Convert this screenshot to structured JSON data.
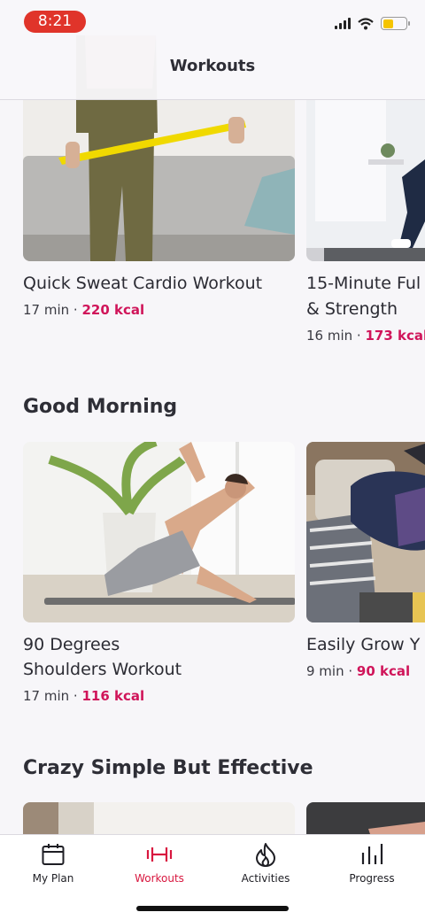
{
  "status_bar": {
    "time": "8:21"
  },
  "header": {
    "title": "Workouts"
  },
  "top_row": [
    {
      "title": "Quick Sweat Cardio Workout",
      "duration": "17 min · ",
      "kcal": "220 kcal"
    },
    {
      "title_line1": "15-Minute Ful",
      "title_line2": "& Strength",
      "duration": "16 min · ",
      "kcal": "173 kcal"
    }
  ],
  "sections": [
    {
      "title": "Good Morning",
      "cards": [
        {
          "title_line1": "90 Degrees",
          "title_line2": "Shoulders Workout",
          "duration": "17 min · ",
          "kcal": "116 kcal"
        },
        {
          "title_line1": "Easily Grow Y",
          "duration": "9 min · ",
          "kcal": "90 kcal"
        }
      ]
    },
    {
      "title": "Crazy Simple But Effective"
    }
  ],
  "tabbar": {
    "tabs": [
      {
        "label": "My Plan",
        "icon": "calendar-icon"
      },
      {
        "label": "Workouts",
        "icon": "dumbbell-icon",
        "active": true
      },
      {
        "label": "Activities",
        "icon": "flame-icon"
      },
      {
        "label": "Progress",
        "icon": "bar-chart-icon"
      }
    ]
  },
  "colors": {
    "accent": "#d8173f",
    "kcal": "#d0155a",
    "time_pill": "#e0342a"
  }
}
